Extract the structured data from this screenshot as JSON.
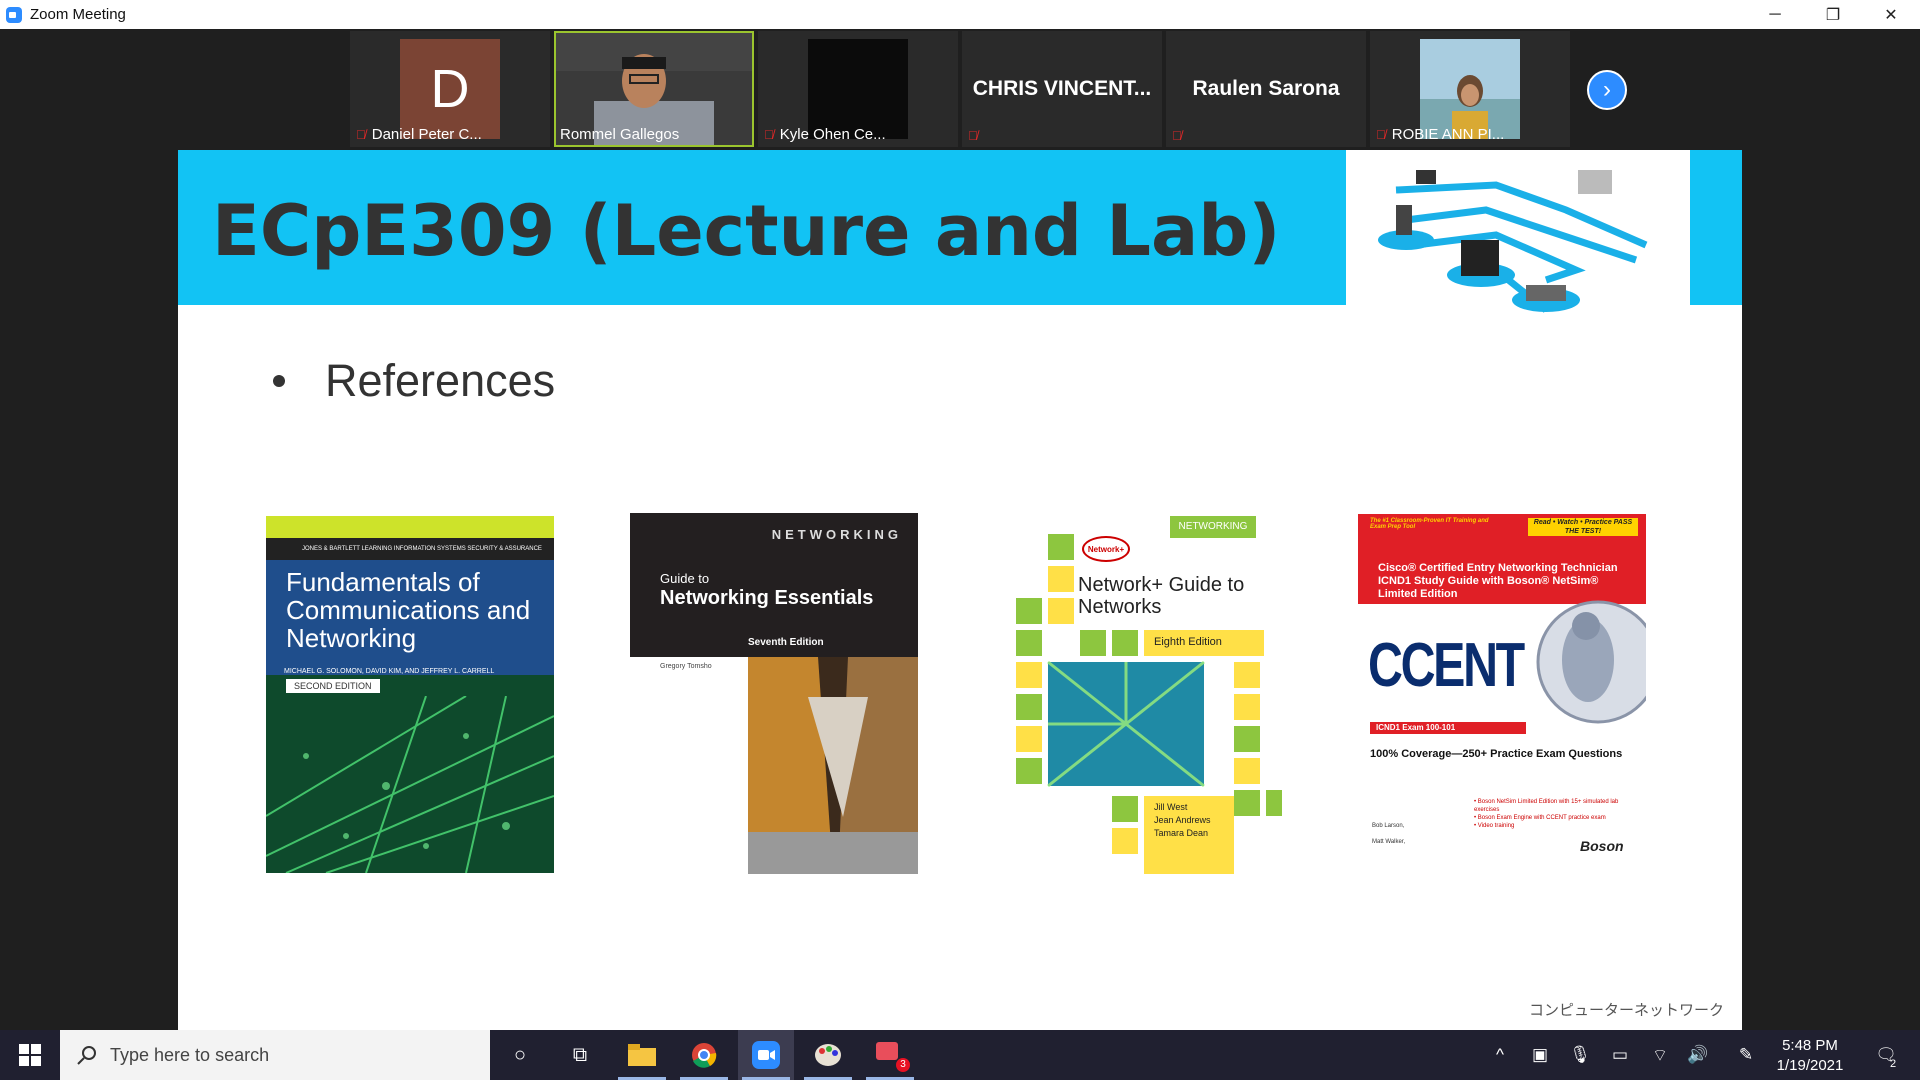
{
  "window": {
    "title": "Zoom Meeting",
    "minimize": "─",
    "restore": "❐",
    "close": "✕"
  },
  "participants": [
    {
      "name": "Daniel Peter C...",
      "avatar_letter": "D",
      "muted": true
    },
    {
      "name": "Rommel Gallegos",
      "muted": false,
      "active": true
    },
    {
      "name": "Kyle Ohen Ce...",
      "muted": true
    },
    {
      "name": "CHRIS  VINCENT...",
      "muted": true
    },
    {
      "name": "Raulen Sarona",
      "muted": true
    },
    {
      "name": "ROBIE ANN PI...",
      "muted": true
    }
  ],
  "next_arrow": "›",
  "slide": {
    "title": "ECpE309 (Lecture and Lab)",
    "bullet": "References",
    "footer_text": "コンピューターネットワーク",
    "books": [
      {
        "series": "JONES & BARTLETT LEARNING  INFORMATION SYSTEMS SECURITY & ASSURANCE SERIES",
        "title": "Fundamentals of Communications and Networking",
        "authors": "MICHAEL G. SOLOMON, DAVID KIM, AND JEFFREY L. CARRELL",
        "edition": "SECOND EDITION"
      },
      {
        "header": "NETWORKING",
        "pretitle": "Guide to",
        "title": "Networking Essentials",
        "edition": "Seventh Edition",
        "author": "Gregory Tomsho"
      },
      {
        "badge": "NETWORKING",
        "logo": "Network+",
        "title": "Network+ Guide to Networks",
        "edition": "Eighth Edition",
        "authors": [
          "Jill West",
          "Jean Andrews",
          "Tamara Dean"
        ]
      },
      {
        "tag_left": "The #1 Classroom-Proven IT Training and Exam Prep Tool",
        "tag_right": "Read • Watch • Practice PASS THE TEST!",
        "subtitle": "Cisco® Certified Entry Networking Technician ICND1 Study Guide with Boson® NetSim® Limited Edition",
        "title": "CCENT",
        "exam": "ICND1 Exam 100-101",
        "coverage": "100% Coverage—250+ Practice Exam Questions",
        "features": [
          "• Boson NetSim Limited Edition with 15+ simulated lab exercises",
          "• Boson Exam Engine with CCENT practice exam",
          "• Video training"
        ],
        "authors": [
          "Bob Larson,",
          "Matt Walker,"
        ],
        "publisher": "Boson"
      }
    ]
  },
  "taskbar": {
    "search_placeholder": "Type here to search",
    "time": "5:48 PM",
    "date": "1/19/2021",
    "notification_count": "2",
    "app_badge": "3"
  }
}
